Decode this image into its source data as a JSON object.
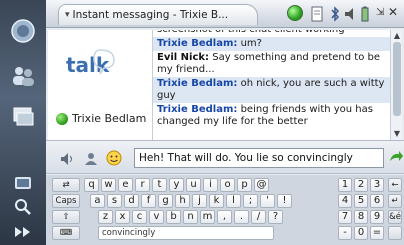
{
  "window": {
    "title": "Instant messaging - Trixie B..."
  },
  "account": {
    "logo_text": "talk",
    "contact_name": "Trixie Bedlam"
  },
  "chat": {
    "messages": [
      {
        "sender": "",
        "text": "screenshot of this chat client working",
        "alt": false,
        "cut": true
      },
      {
        "sender": "Trixie Bedlam:",
        "text": "um?",
        "alt": true,
        "who": "trixie"
      },
      {
        "sender": "Evil Nick:",
        "text": "Say something and pretend to be my friend...",
        "alt": false,
        "who": "nick"
      },
      {
        "sender": "Trixie Bedlam:",
        "text": "oh nick, you are such a witty guy",
        "alt": true,
        "who": "trixie"
      },
      {
        "sender": "Trixie Bedlam:",
        "text": "being friends with you has changed my life for the better",
        "alt": false,
        "who": "trixie"
      }
    ]
  },
  "compose": {
    "input_value": "Heh! That will do. You lie so convincingly"
  },
  "keyboard": {
    "row1": [
      "q",
      "w",
      "e",
      "r",
      "t",
      "y",
      "u",
      "i",
      "o",
      "p",
      "@"
    ],
    "row2": [
      "a",
      "s",
      "d",
      "f",
      "g",
      "h",
      "j",
      "k",
      "l",
      ";",
      "'",
      "!"
    ],
    "row3": [
      "z",
      "x",
      "c",
      "v",
      "b",
      "n",
      "m",
      ",",
      ".",
      "/",
      "?"
    ],
    "caps_label": "Caps",
    "space_text": "convincingly",
    "num_row1": [
      "1",
      "2",
      "3"
    ],
    "num_row2": [
      "4",
      "5",
      "6"
    ],
    "num_row3": [
      "7",
      "8",
      "9"
    ],
    "num_row4": [
      "-",
      "0",
      "="
    ],
    "right_keys": [
      "←",
      "↵",
      "&é",
      ""
    ]
  },
  "colors": {
    "accent": "#1747a6",
    "highlight_row": "#dde7f3",
    "send_arrow": "#3aa12a"
  }
}
